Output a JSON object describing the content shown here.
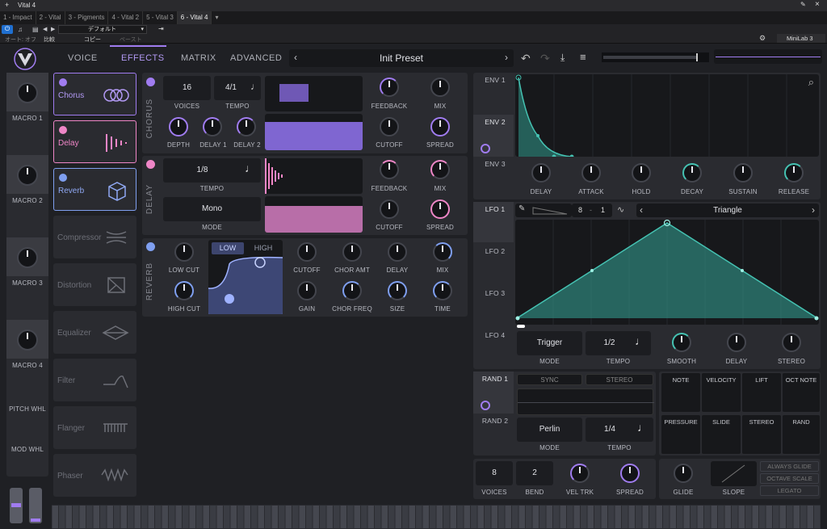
{
  "host": {
    "title": "Vital 4",
    "tabs": [
      "1 - Impact",
      "2 - Vital",
      "3 - Pigments",
      "4 - Vital 2",
      "5 - Vital 3",
      "6 - Vital 4"
    ],
    "active_tab": 5,
    "preset_host": "デフォルト",
    "autooff": "オート: オフ",
    "compare": "比較",
    "copy": "コピー",
    "paste": "ペースト",
    "device": "MiniLab 3"
  },
  "nav": {
    "tabs": [
      "VOICE",
      "EFFECTS",
      "MATRIX",
      "ADVANCED"
    ],
    "active": "EFFECTS",
    "preset": "Init Preset"
  },
  "macros": [
    "MACRO 1",
    "MACRO 2",
    "MACRO 3",
    "MACRO 4"
  ],
  "wheels": {
    "pitch": "PITCH WHL",
    "mod": "MOD WHL"
  },
  "fx_list": [
    "Chorus",
    "Delay",
    "Reverb",
    "Compressor",
    "Distortion",
    "Equalizer",
    "Filter",
    "Flanger",
    "Phaser"
  ],
  "chorus": {
    "name": "CHORUS",
    "voices": "16",
    "voices_lbl": "VOICES",
    "tempo": "4/1",
    "tempo_lbl": "TEMPO",
    "feedback": "FEEDBACK",
    "mix": "MIX",
    "depth": "DEPTH",
    "delay1": "DELAY 1",
    "delay2": "DELAY 2",
    "cutoff": "CUTOFF",
    "spread": "SPREAD"
  },
  "delay": {
    "name": "DELAY",
    "tempo": "1/8",
    "tempo_lbl": "TEMPO",
    "mode": "Mono",
    "mode_lbl": "MODE",
    "feedback": "FEEDBACK",
    "mix": "MIX",
    "cutoff": "CUTOFF",
    "spread": "SPREAD"
  },
  "reverb": {
    "name": "REVERB",
    "low": "LOW",
    "high": "HIGH",
    "low_cut": "LOW CUT",
    "high_cut": "HIGH CUT",
    "cutoff": "CUTOFF",
    "chor_amt": "CHOR AMT",
    "delay": "DELAY",
    "mix": "MIX",
    "gain": "GAIN",
    "chor_freq": "CHOR FREQ",
    "size": "SIZE",
    "time": "TIME"
  },
  "env": {
    "tabs": [
      "ENV 1",
      "ENV 2",
      "ENV 3"
    ],
    "knobs": [
      "DELAY",
      "ATTACK",
      "HOLD",
      "DECAY",
      "SUSTAIN",
      "RELEASE"
    ]
  },
  "lfo": {
    "tabs": [
      "LFO 1",
      "LFO 2",
      "LFO 3",
      "LFO 4"
    ],
    "grid_x": "8",
    "grid_y": "1",
    "shape": "Triangle",
    "mode": "Trigger",
    "mode_lbl": "MODE",
    "tempo": "1/2",
    "tempo_lbl": "TEMPO",
    "smooth": "SMOOTH",
    "delay": "DELAY",
    "stereo": "STEREO"
  },
  "rand": {
    "tabs": [
      "RAND 1",
      "RAND 2"
    ],
    "sync": "SYNC",
    "stereo": "STEREO",
    "mode": "Perlin",
    "mode_lbl": "MODE",
    "tempo": "1/4",
    "tempo_lbl": "TEMPO"
  },
  "mod_sources": [
    "NOTE",
    "VELOCITY",
    "LIFT",
    "OCT NOTE",
    "PRESSURE",
    "SLIDE",
    "STEREO",
    "RAND"
  ],
  "voice": {
    "voices": "8",
    "voices_lbl": "VOICES",
    "bend": "2",
    "bend_lbl": "BEND",
    "vel_trk": "VEL TRK",
    "spread": "SPREAD"
  },
  "glide": {
    "glide": "GLIDE",
    "slope": "SLOPE",
    "always": "ALWAYS GLIDE",
    "octave": "OCTAVE SCALE",
    "legato": "LEGATO"
  },
  "colors": {
    "purple": "#a07cf0",
    "pink": "#ef86c7",
    "teal": "#45c2b2"
  }
}
